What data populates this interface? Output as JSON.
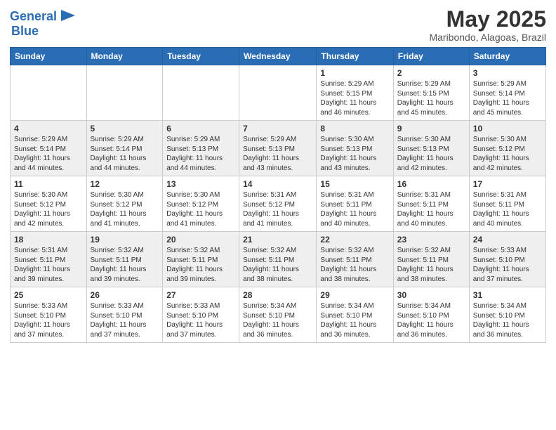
{
  "header": {
    "logo_line1": "General",
    "logo_line2": "Blue",
    "month": "May 2025",
    "location": "Maribondo, Alagoas, Brazil"
  },
  "weekdays": [
    "Sunday",
    "Monday",
    "Tuesday",
    "Wednesday",
    "Thursday",
    "Friday",
    "Saturday"
  ],
  "weeks": [
    [
      {
        "day": "",
        "info": ""
      },
      {
        "day": "",
        "info": ""
      },
      {
        "day": "",
        "info": ""
      },
      {
        "day": "",
        "info": ""
      },
      {
        "day": "1",
        "info": "Sunrise: 5:29 AM\nSunset: 5:15 PM\nDaylight: 11 hours\nand 46 minutes."
      },
      {
        "day": "2",
        "info": "Sunrise: 5:29 AM\nSunset: 5:15 PM\nDaylight: 11 hours\nand 45 minutes."
      },
      {
        "day": "3",
        "info": "Sunrise: 5:29 AM\nSunset: 5:14 PM\nDaylight: 11 hours\nand 45 minutes."
      }
    ],
    [
      {
        "day": "4",
        "info": "Sunrise: 5:29 AM\nSunset: 5:14 PM\nDaylight: 11 hours\nand 44 minutes."
      },
      {
        "day": "5",
        "info": "Sunrise: 5:29 AM\nSunset: 5:14 PM\nDaylight: 11 hours\nand 44 minutes."
      },
      {
        "day": "6",
        "info": "Sunrise: 5:29 AM\nSunset: 5:13 PM\nDaylight: 11 hours\nand 44 minutes."
      },
      {
        "day": "7",
        "info": "Sunrise: 5:29 AM\nSunset: 5:13 PM\nDaylight: 11 hours\nand 43 minutes."
      },
      {
        "day": "8",
        "info": "Sunrise: 5:30 AM\nSunset: 5:13 PM\nDaylight: 11 hours\nand 43 minutes."
      },
      {
        "day": "9",
        "info": "Sunrise: 5:30 AM\nSunset: 5:13 PM\nDaylight: 11 hours\nand 42 minutes."
      },
      {
        "day": "10",
        "info": "Sunrise: 5:30 AM\nSunset: 5:12 PM\nDaylight: 11 hours\nand 42 minutes."
      }
    ],
    [
      {
        "day": "11",
        "info": "Sunrise: 5:30 AM\nSunset: 5:12 PM\nDaylight: 11 hours\nand 42 minutes."
      },
      {
        "day": "12",
        "info": "Sunrise: 5:30 AM\nSunset: 5:12 PM\nDaylight: 11 hours\nand 41 minutes."
      },
      {
        "day": "13",
        "info": "Sunrise: 5:30 AM\nSunset: 5:12 PM\nDaylight: 11 hours\nand 41 minutes."
      },
      {
        "day": "14",
        "info": "Sunrise: 5:31 AM\nSunset: 5:12 PM\nDaylight: 11 hours\nand 41 minutes."
      },
      {
        "day": "15",
        "info": "Sunrise: 5:31 AM\nSunset: 5:11 PM\nDaylight: 11 hours\nand 40 minutes."
      },
      {
        "day": "16",
        "info": "Sunrise: 5:31 AM\nSunset: 5:11 PM\nDaylight: 11 hours\nand 40 minutes."
      },
      {
        "day": "17",
        "info": "Sunrise: 5:31 AM\nSunset: 5:11 PM\nDaylight: 11 hours\nand 40 minutes."
      }
    ],
    [
      {
        "day": "18",
        "info": "Sunrise: 5:31 AM\nSunset: 5:11 PM\nDaylight: 11 hours\nand 39 minutes."
      },
      {
        "day": "19",
        "info": "Sunrise: 5:32 AM\nSunset: 5:11 PM\nDaylight: 11 hours\nand 39 minutes."
      },
      {
        "day": "20",
        "info": "Sunrise: 5:32 AM\nSunset: 5:11 PM\nDaylight: 11 hours\nand 39 minutes."
      },
      {
        "day": "21",
        "info": "Sunrise: 5:32 AM\nSunset: 5:11 PM\nDaylight: 11 hours\nand 38 minutes."
      },
      {
        "day": "22",
        "info": "Sunrise: 5:32 AM\nSunset: 5:11 PM\nDaylight: 11 hours\nand 38 minutes."
      },
      {
        "day": "23",
        "info": "Sunrise: 5:32 AM\nSunset: 5:11 PM\nDaylight: 11 hours\nand 38 minutes."
      },
      {
        "day": "24",
        "info": "Sunrise: 5:33 AM\nSunset: 5:10 PM\nDaylight: 11 hours\nand 37 minutes."
      }
    ],
    [
      {
        "day": "25",
        "info": "Sunrise: 5:33 AM\nSunset: 5:10 PM\nDaylight: 11 hours\nand 37 minutes."
      },
      {
        "day": "26",
        "info": "Sunrise: 5:33 AM\nSunset: 5:10 PM\nDaylight: 11 hours\nand 37 minutes."
      },
      {
        "day": "27",
        "info": "Sunrise: 5:33 AM\nSunset: 5:10 PM\nDaylight: 11 hours\nand 37 minutes."
      },
      {
        "day": "28",
        "info": "Sunrise: 5:34 AM\nSunset: 5:10 PM\nDaylight: 11 hours\nand 36 minutes."
      },
      {
        "day": "29",
        "info": "Sunrise: 5:34 AM\nSunset: 5:10 PM\nDaylight: 11 hours\nand 36 minutes."
      },
      {
        "day": "30",
        "info": "Sunrise: 5:34 AM\nSunset: 5:10 PM\nDaylight: 11 hours\nand 36 minutes."
      },
      {
        "day": "31",
        "info": "Sunrise: 5:34 AM\nSunset: 5:10 PM\nDaylight: 11 hours\nand 36 minutes."
      }
    ]
  ]
}
